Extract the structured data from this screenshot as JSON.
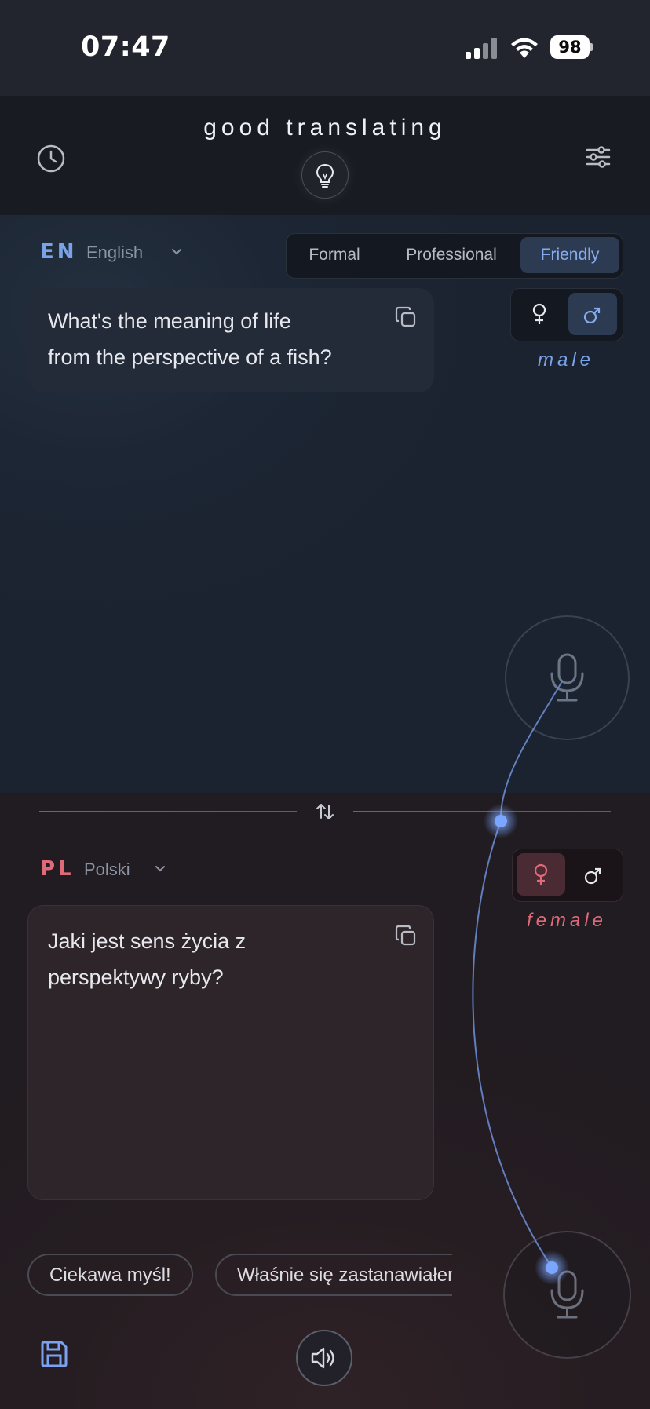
{
  "status_bar": {
    "time": "07:47",
    "battery": "98"
  },
  "header": {
    "title": "good translating"
  },
  "source": {
    "lang_code": "EN",
    "lang_name": "English",
    "text_lines": [
      "What's the meaning of life",
      "from the perspective of a fish?"
    ],
    "gender_label": "male",
    "selected_gender": "male"
  },
  "tones": {
    "options": [
      "Formal",
      "Professional",
      "Friendly"
    ],
    "selected": "Friendly"
  },
  "target": {
    "lang_code": "PL",
    "lang_name": "Polski",
    "text_lines": [
      "Jaki jest sens życia z",
      "perspektywy ryby?"
    ],
    "gender_label": "female",
    "selected_gender": "female"
  },
  "suggestions": [
    "Ciekawa myśl!",
    "Właśnie się zastanawiałem"
  ],
  "colors": {
    "accent_blue": "#86abef",
    "accent_red": "#e06a7a",
    "line_glow": "#6f9cff"
  },
  "icons": {
    "history": "clock-icon",
    "bulb": "lightbulb-icon",
    "settings": "sliders-icon",
    "copy": "copy-icon",
    "swap": "swap-vertical-icon",
    "mic": "microphone-icon",
    "save": "floppy-disk-icon",
    "speaker": "speaker-icon"
  }
}
